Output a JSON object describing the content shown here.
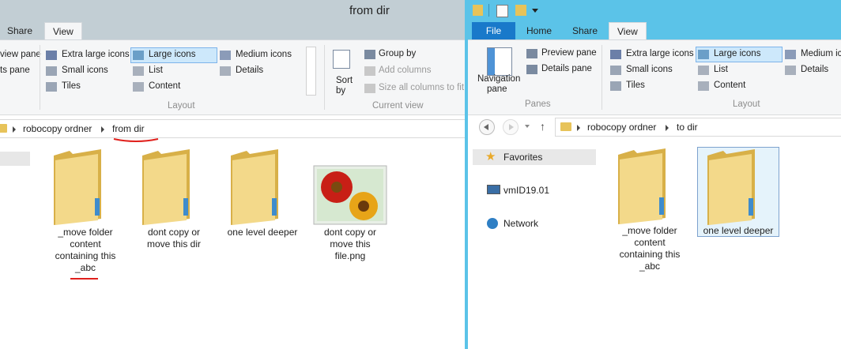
{
  "left": {
    "title": "from dir",
    "tabs": [
      "Share",
      "View"
    ],
    "ribbon": {
      "pane_items": [
        "view pane",
        "ts pane"
      ],
      "layout_items": [
        "Extra large icons",
        "Large icons",
        "Medium icons",
        "Small icons",
        "List",
        "Details",
        "Tiles",
        "Content"
      ],
      "layout_group": "Layout",
      "sort_label": "Sort",
      "sort_by": "by",
      "group_by": "Group by",
      "add_columns": "Add columns",
      "size_columns": "Size all columns to fit",
      "current_view_group": "Current view"
    },
    "breadcrumb": [
      "robocopy ordner",
      "from dir"
    ],
    "items": [
      {
        "label": [
          "_move folder",
          "content",
          "containing this",
          "_abc"
        ],
        "type": "folder"
      },
      {
        "label": [
          "dont copy or",
          "move this dir"
        ],
        "type": "folder"
      },
      {
        "label": [
          "one level deeper"
        ],
        "type": "folder"
      },
      {
        "label": [
          "dont copy or",
          "move this",
          "file.png"
        ],
        "type": "image"
      }
    ]
  },
  "right": {
    "tabs": [
      "File",
      "Home",
      "Share",
      "View"
    ],
    "ribbon": {
      "nav_pane": "Navigation",
      "nav_pane2": "pane",
      "preview_pane": "Preview pane",
      "details_pane": "Details pane",
      "panes_group": "Panes",
      "layout_items": [
        "Extra large icons",
        "Large icons",
        "Medium ic",
        "Small icons",
        "List",
        "Details",
        "Tiles",
        "Content"
      ],
      "layout_group": "Layout"
    },
    "breadcrumb": [
      "robocopy ordner",
      "to dir"
    ],
    "nav": {
      "favorites": "Favorites",
      "computer": "vmID19.01",
      "network": "Network"
    },
    "items": [
      {
        "label": [
          "_move folder",
          "content",
          "containing this",
          "_abc"
        ],
        "type": "folder"
      },
      {
        "label": [
          "one level deeper"
        ],
        "type": "folder",
        "selected": true
      }
    ]
  },
  "colors": {
    "accent": "#5bc3e8",
    "file_tab": "#1979ca",
    "selection": "#cde8fb",
    "annotation": "#e0201c",
    "folder": "#e7c35a"
  }
}
